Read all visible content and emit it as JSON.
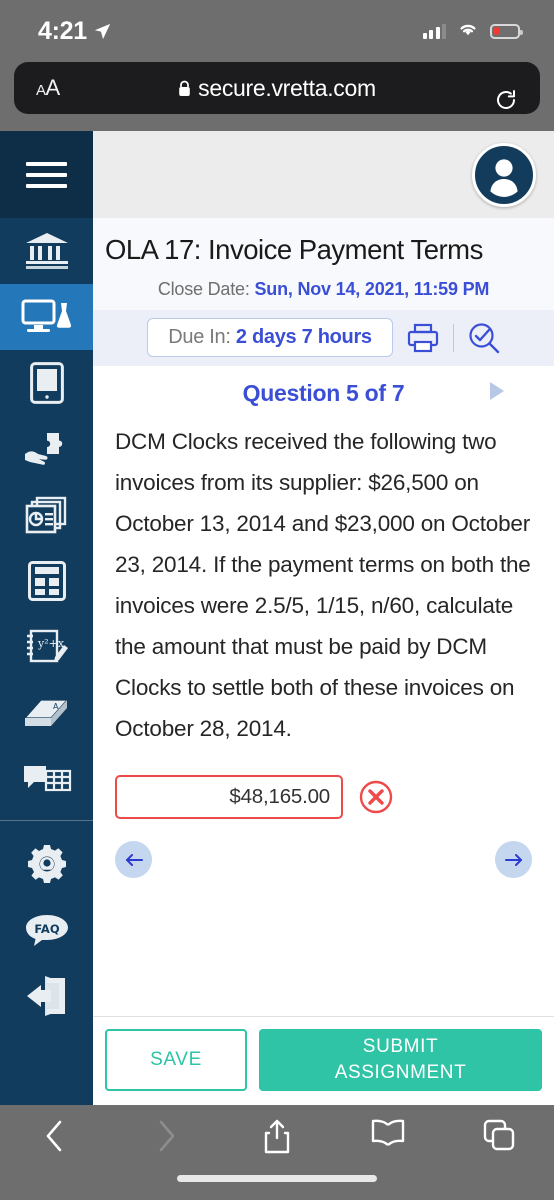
{
  "status_bar": {
    "time": "4:21",
    "location_icon": "location-arrow-icon",
    "signal_icon": "cellular-signal-icon",
    "wifi_icon": "wifi-icon",
    "battery_icon": "battery-low-icon",
    "battery_level_percent": 22,
    "battery_color": "#f23a33"
  },
  "browser": {
    "text_size_label": "A",
    "text_size_label_small": "A",
    "lock_icon": "lock-icon",
    "url": "secure.vretta.com",
    "reload_icon": "reload-icon",
    "toolbar": {
      "back_icon": "chevron-left-icon",
      "forward_icon": "chevron-right-icon",
      "share_icon": "share-icon",
      "bookmarks_icon": "book-icon",
      "tabs_icon": "tabs-icon"
    }
  },
  "sidebar": {
    "menu_icon": "hamburger-menu-icon",
    "active_index": 1,
    "items": [
      {
        "icon": "bank-institution-icon",
        "label": "Institution"
      },
      {
        "icon": "computer-lab-icon",
        "label": "Online Lab"
      },
      {
        "icon": "tablet-reader-icon",
        "label": "eBook"
      },
      {
        "icon": "hand-puzzle-icon",
        "label": "Practice"
      },
      {
        "icon": "report-chart-icon",
        "label": "Reports"
      },
      {
        "icon": "calculator-icon",
        "label": "Calculator"
      },
      {
        "icon": "formula-notepad-icon",
        "label": "Formula Sheet"
      },
      {
        "icon": "dictionary-book-icon",
        "label": "Glossary"
      },
      {
        "icon": "chat-table-icon",
        "label": "Discussion"
      }
    ],
    "bottom_items": [
      {
        "icon": "gear-settings-icon",
        "label": "Settings"
      },
      {
        "icon": "faq-bubble-icon",
        "label": "FAQ"
      },
      {
        "icon": "exit-door-icon",
        "label": "Log Out"
      }
    ]
  },
  "header": {
    "avatar_icon": "user-avatar-icon",
    "title": "OLA 17: Invoice Payment Terms",
    "close_date_label": "Close Date:",
    "close_date_value": "Sun, Nov 14, 2021, 11:59 PM"
  },
  "due_bar": {
    "due_label": "Due In:",
    "due_value": "2 days 7 hours",
    "print_icon": "print-icon",
    "review_icon": "check-magnifier-icon"
  },
  "question": {
    "counter": "Question 5 of 7",
    "next_icon": "play-triangle-right-icon",
    "text": "DCM Clocks received the following two invoices from its supplier: $26,500 on October 13, 2014 and $23,000 on October 23, 2014. If the payment terms on both the invoices were 2.5/5, 1/15, n/60, calculate the amount that must be paid by DCM Clocks to settle both of these invoices on October 28, 2014.",
    "answer_value": "$48,165.00",
    "answer_placeholder": "",
    "answer_state": "incorrect",
    "answer_border_color": "#ed4a4a",
    "incorrect_icon": "circle-x-icon",
    "prev_icon": "arrow-left-icon",
    "next_nav_icon": "arrow-right-icon"
  },
  "footer": {
    "save_label": "SAVE",
    "submit_label_line1": "SUBMIT",
    "submit_label_line2": "ASSIGNMENT",
    "accent_color": "#2ec4a5"
  },
  "colors": {
    "sidebar": "#123c5e",
    "sidebar_dark": "#0e2d46",
    "sidebar_active": "#2477b8",
    "link_blue": "#3b4fd6",
    "error_red": "#ed4a4a",
    "teal": "#2ec4a5"
  }
}
